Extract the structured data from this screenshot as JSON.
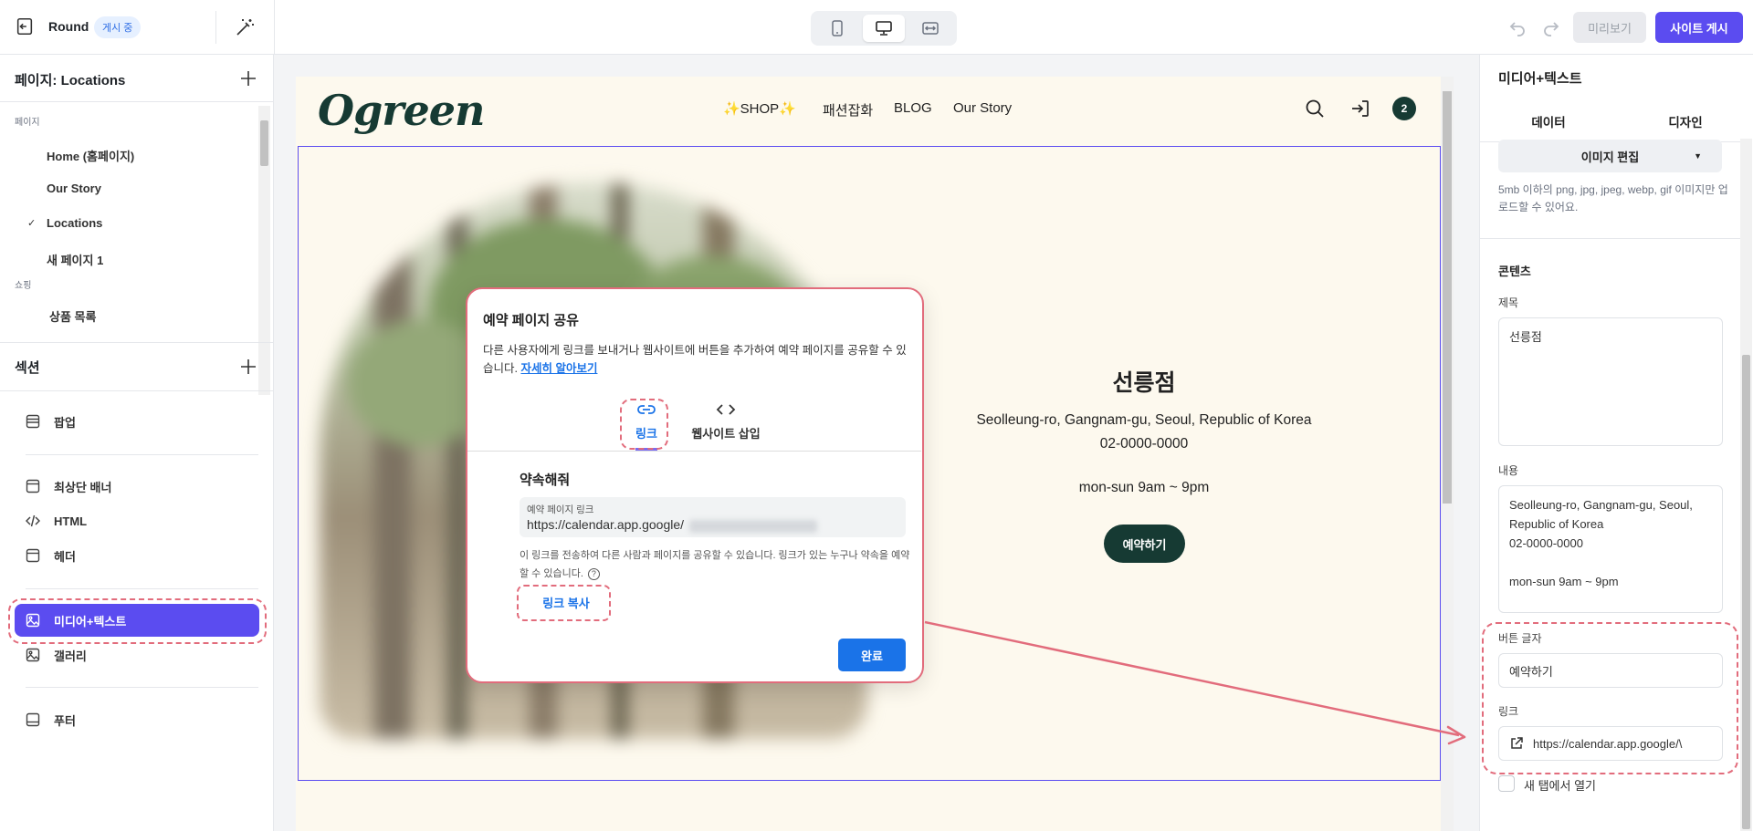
{
  "topbar": {
    "site_name": "Round",
    "status_badge": "게시 중",
    "preview_label": "미리보기",
    "publish_label": "사이트 게시"
  },
  "sidebar": {
    "pages_header": "페이지: Locations",
    "group_pages": "페이지",
    "pages": [
      {
        "label": "Home (홈페이지)"
      },
      {
        "label": "Our Story"
      },
      {
        "label": "Locations",
        "current": true
      },
      {
        "label": "새 페이지 1"
      }
    ],
    "group_shop": "쇼핑",
    "shop_pages": [
      {
        "label": "상품 목록"
      }
    ],
    "sections_header": "섹션",
    "sections": [
      {
        "label": "팝업",
        "icon": "popup-icon"
      },
      {
        "label": "최상단 배너",
        "icon": "banner-icon"
      },
      {
        "label": "HTML",
        "icon": "code-icon"
      },
      {
        "label": "헤더",
        "icon": "header-icon"
      },
      {
        "label": "미디어+텍스트",
        "icon": "image-icon",
        "active": true
      },
      {
        "label": "갤러리",
        "icon": "image-icon"
      },
      {
        "label": "푸터",
        "icon": "footer-icon"
      }
    ]
  },
  "site": {
    "logo": "Ogreen",
    "nav": [
      "✨SHOP✨",
      "패션잡화",
      "BLOG",
      "Our Story"
    ],
    "cart_count": "2",
    "store_title": "선릉점",
    "store_address": "Seolleung-ro, Gangnam-gu, Seoul, Republic of Korea",
    "store_phone": "02-0000-0000",
    "store_hours": "mon-sun 9am ~ 9pm",
    "book_button": "예약하기"
  },
  "modal": {
    "title": "예약 페이지 공유",
    "description": "다른 사용자에게 링크를 보내거나 웹사이트에 버튼을 추가하여 예약 페이지를 공유할 수 있습니다.",
    "learn_more": "자세히 알아보기",
    "tab_link": "링크",
    "tab_embed": "웹사이트 삽입",
    "booking_name": "약속해줘",
    "field_label": "예약 페이지 링크",
    "field_value": "https://calendar.app.google/",
    "note": "이 링크를 전송하여 다른 사람과 페이지를 공유할 수 있습니다. 링크가 있는 누구나 약속을 예약할 수 있습니다.",
    "copy_label": "링크 복사",
    "done_label": "완료"
  },
  "panel": {
    "title": "미디어+텍스트",
    "tab_data": "데이터",
    "tab_design": "디자인",
    "image_edit": "이미지 편집",
    "upload_hint": "5mb 이하의 png, jpg, jpeg, webp, gif 이미지만 업로드할 수 있어요.",
    "content_section": "콘텐츠",
    "title_label": "제목",
    "title_value": "선릉점",
    "body_label": "내용",
    "body_value": "Seolleung-ro, Gangnam-gu, Seoul, Republic of Korea\n02-0000-0000\n\nmon-sun 9am ~ 9pm",
    "button_text_label": "버튼 글자",
    "button_text_value": "예약하기",
    "link_label": "링크",
    "link_value": "https://calendar.app.google/\\",
    "new_tab_label": "새 탭에서 열기"
  },
  "colors": {
    "accent": "#5b4cf0",
    "brand_dark": "#163a33",
    "site_bg": "#fdf9ee",
    "google_blue": "#1a73e8",
    "annotation": "#e26c7c"
  }
}
